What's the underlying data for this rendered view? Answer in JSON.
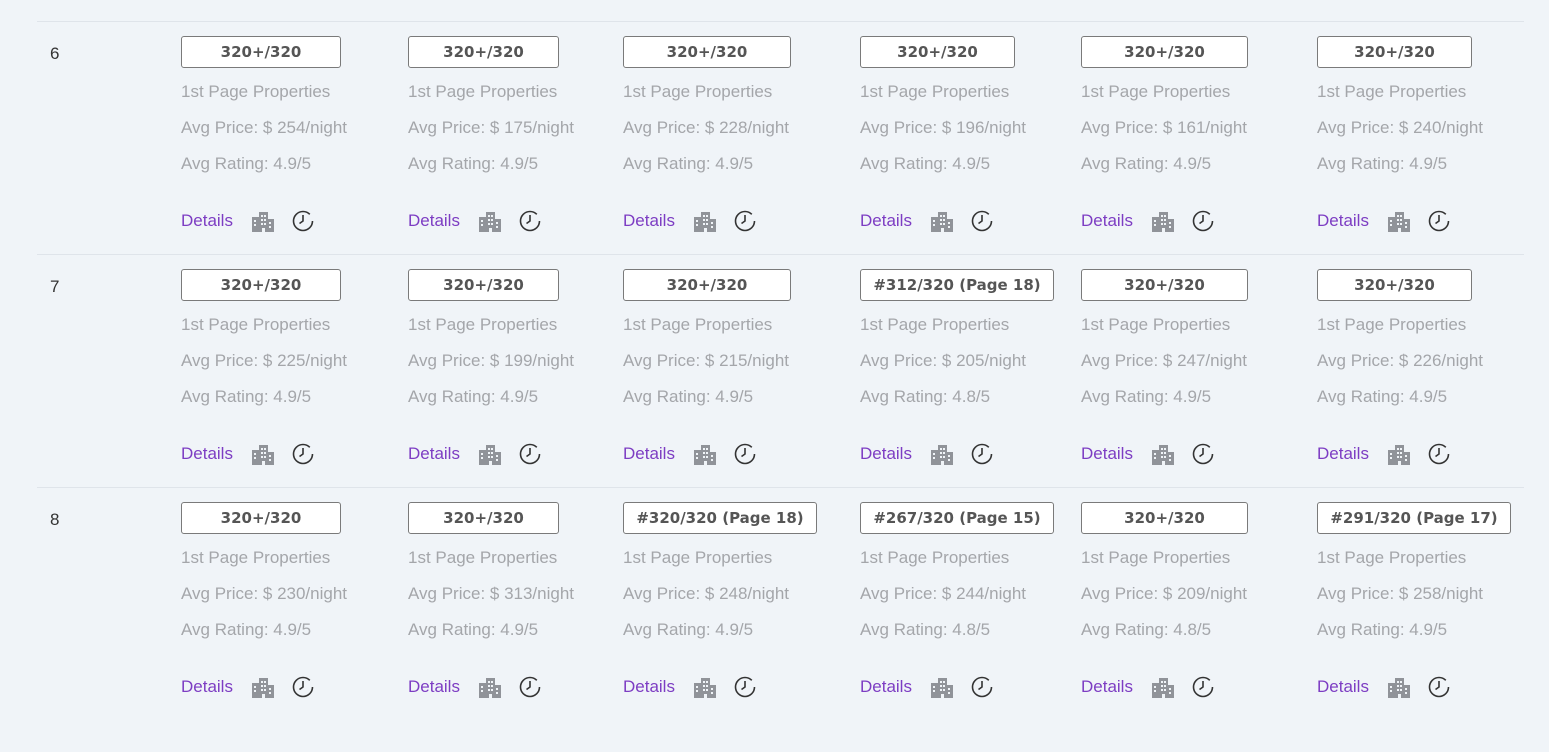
{
  "info_label": "1st Page Properties",
  "details_label": "Details",
  "colors": {
    "link": "#7d3dc3",
    "muted": "#a4a6aa",
    "background": "#f0f4f8"
  },
  "icons": {
    "building": "building-icon",
    "history": "clock-history-icon"
  },
  "rows": [
    {
      "num": "6",
      "cells": [
        {
          "rank": "320+/320",
          "price": "Avg Price: $ 254/night",
          "rating": "Avg Rating: 4.9/5"
        },
        {
          "rank": "320+/320",
          "price": "Avg Price: $ 175/night",
          "rating": "Avg Rating: 4.9/5"
        },
        {
          "rank": "320+/320",
          "price": "Avg Price: $ 228/night",
          "rating": "Avg Rating: 4.9/5"
        },
        {
          "rank": "320+/320",
          "price": "Avg Price: $ 196/night",
          "rating": "Avg Rating: 4.9/5"
        },
        {
          "rank": "320+/320",
          "price": "Avg Price: $ 161/night",
          "rating": "Avg Rating: 4.9/5"
        },
        {
          "rank": "320+/320",
          "price": "Avg Price: $ 240/night",
          "rating": "Avg Rating: 4.9/5"
        }
      ]
    },
    {
      "num": "7",
      "cells": [
        {
          "rank": "320+/320",
          "price": "Avg Price: $ 225/night",
          "rating": "Avg Rating: 4.9/5"
        },
        {
          "rank": "320+/320",
          "price": "Avg Price: $ 199/night",
          "rating": "Avg Rating: 4.9/5"
        },
        {
          "rank": "320+/320",
          "price": "Avg Price: $ 215/night",
          "rating": "Avg Rating: 4.9/5"
        },
        {
          "rank": "#312/320 (Page 18)",
          "price": "Avg Price: $ 205/night",
          "rating": "Avg Rating: 4.8/5"
        },
        {
          "rank": "320+/320",
          "price": "Avg Price: $ 247/night",
          "rating": "Avg Rating: 4.9/5"
        },
        {
          "rank": "320+/320",
          "price": "Avg Price: $ 226/night",
          "rating": "Avg Rating: 4.9/5"
        }
      ]
    },
    {
      "num": "8",
      "cells": [
        {
          "rank": "320+/320",
          "price": "Avg Price: $ 230/night",
          "rating": "Avg Rating: 4.9/5"
        },
        {
          "rank": "320+/320",
          "price": "Avg Price: $ 313/night",
          "rating": "Avg Rating: 4.9/5"
        },
        {
          "rank": "#320/320 (Page 18)",
          "price": "Avg Price: $ 248/night",
          "rating": "Avg Rating: 4.9/5"
        },
        {
          "rank": "#267/320 (Page 15)",
          "price": "Avg Price: $ 244/night",
          "rating": "Avg Rating: 4.8/5"
        },
        {
          "rank": "320+/320",
          "price": "Avg Price: $ 209/night",
          "rating": "Avg Rating: 4.8/5"
        },
        {
          "rank": "#291/320 (Page 17)",
          "price": "Avg Price: $ 258/night",
          "rating": "Avg Rating: 4.9/5"
        }
      ]
    }
  ]
}
